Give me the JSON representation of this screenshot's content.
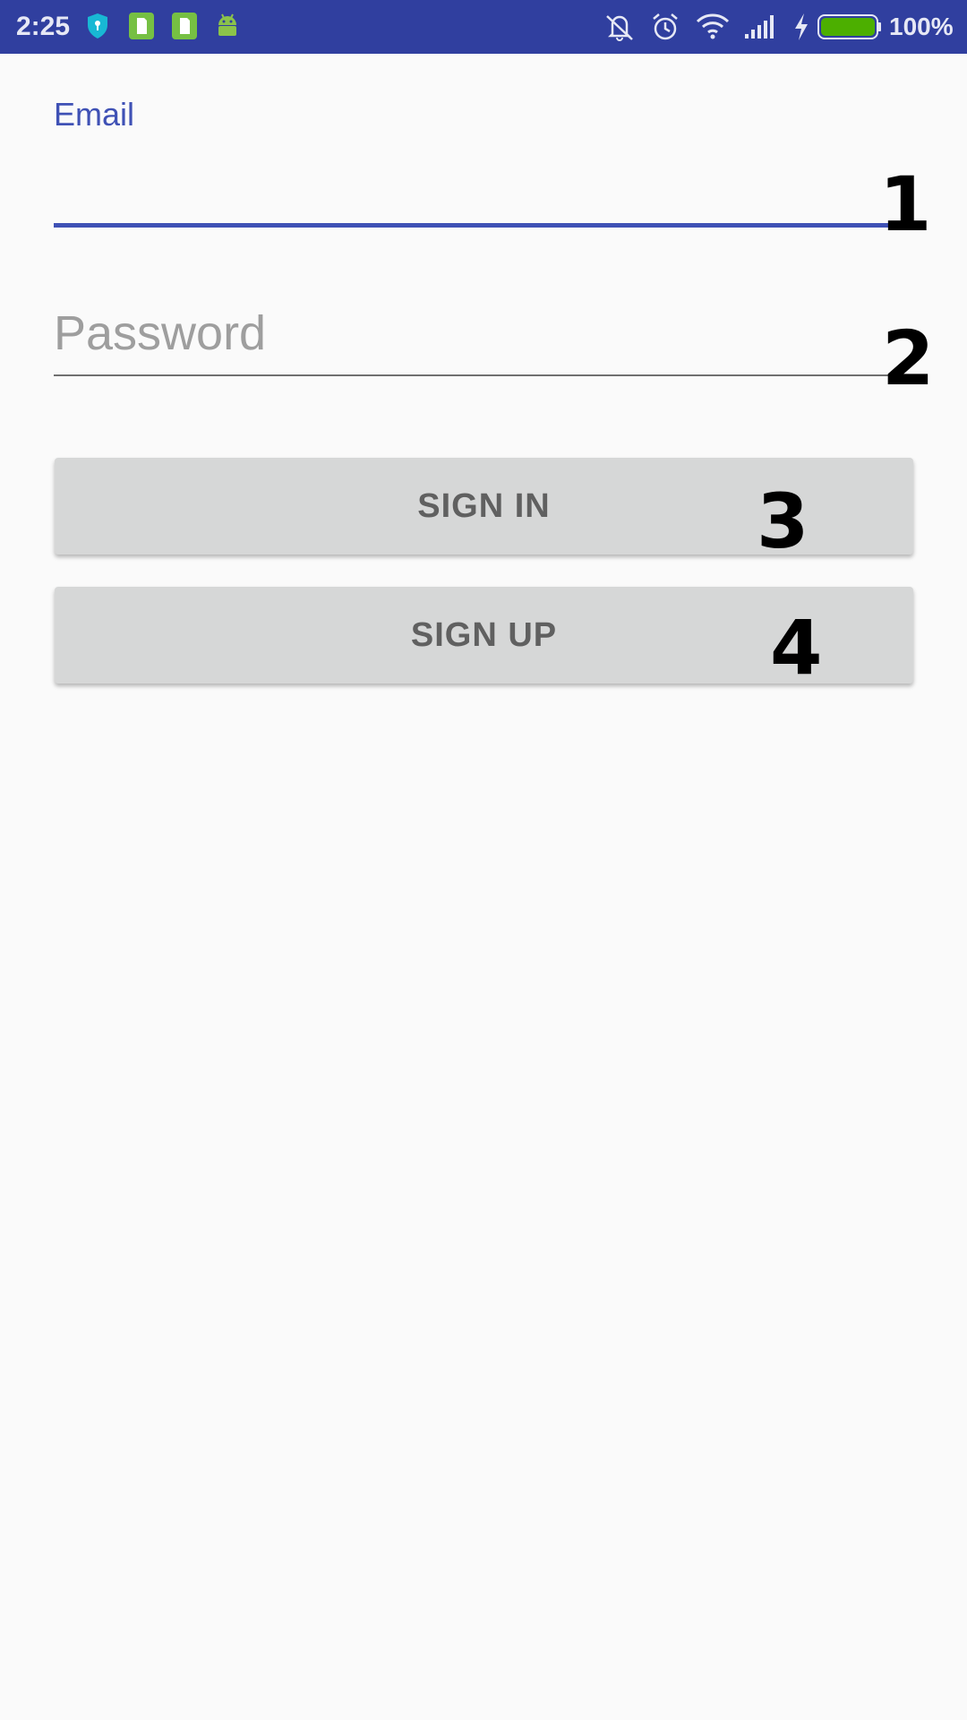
{
  "status_bar": {
    "time": "2:25",
    "battery_percent": "100%",
    "battery_level": 1.0,
    "colors": {
      "background": "#303f9f",
      "battery_fill": "#4caf00",
      "shield": "#18b8d4",
      "notif_green": "#76c043"
    },
    "icons": [
      "shield-icon",
      "sim-card-icon",
      "sim-card-icon",
      "android-icon",
      "vibrate-off-icon",
      "alarm-icon",
      "wifi-icon",
      "signal-icon",
      "charging-icon",
      "battery-icon"
    ]
  },
  "form": {
    "email": {
      "label": "Email",
      "value": ""
    },
    "password": {
      "placeholder": "Password",
      "value": ""
    }
  },
  "buttons": {
    "sign_in": "SIGN IN",
    "sign_up": "SIGN UP"
  },
  "annotations": [
    "1",
    "2",
    "3",
    "4"
  ],
  "colors": {
    "accent": "#3f51b5",
    "button_bg": "#d6d7d7",
    "button_text": "#606060",
    "hint_text": "#9e9e9e"
  }
}
